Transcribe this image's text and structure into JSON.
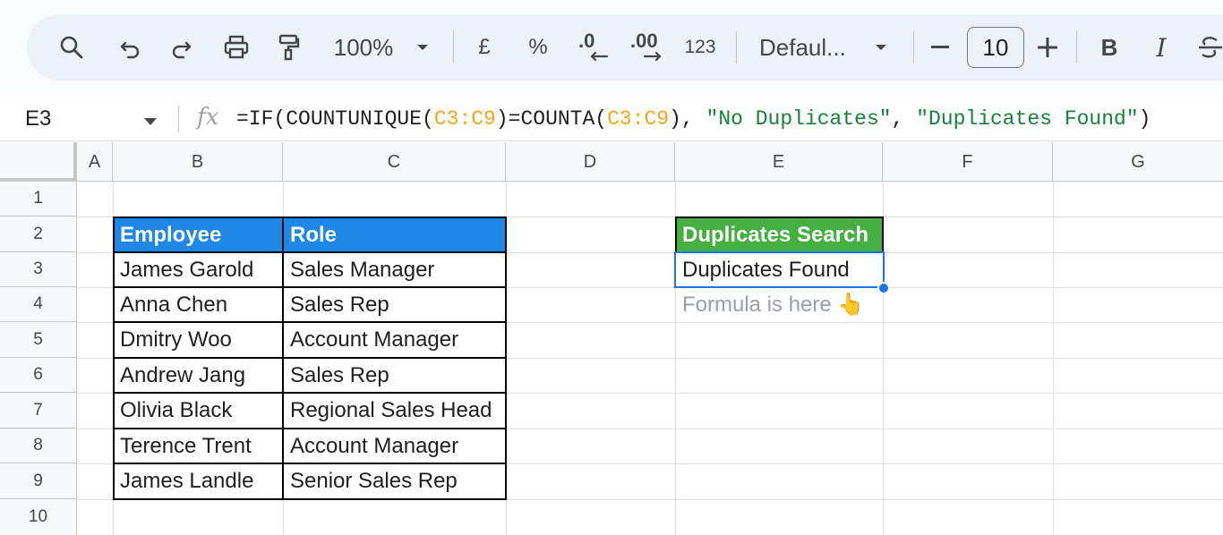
{
  "toolbar": {
    "zoom": "100%",
    "currency": "£",
    "percent": "%",
    "decrease_decimal": ".0",
    "increase_decimal": ".00",
    "number_format": "123",
    "font": "Defaul...",
    "font_size": "10",
    "bold": "B",
    "italic": "I"
  },
  "formula_bar": {
    "cell_ref": "E3",
    "fx": "fx",
    "formula_parts": {
      "p1": "=IF(COUNTUNIQUE(",
      "p2": "C3:C9",
      "p3": ")=COUNTA(",
      "p4": "C3:C9",
      "p5": "), ",
      "p6": "\"No Duplicates\"",
      "p7": ", ",
      "p8": "\"Duplicates Found\"",
      "p9": ")"
    }
  },
  "columns": [
    "A",
    "B",
    "C",
    "D",
    "E",
    "F",
    "G"
  ],
  "rows": [
    "1",
    "2",
    "3",
    "4",
    "5",
    "6",
    "7",
    "8",
    "9",
    "10"
  ],
  "table": {
    "headers": {
      "employee": "Employee",
      "role": "Role"
    },
    "rows": [
      {
        "employee": "James Garold",
        "role": "Sales Manager"
      },
      {
        "employee": "Anna Chen",
        "role": "Sales Rep"
      },
      {
        "employee": "Dmitry Woo",
        "role": "Account Manager"
      },
      {
        "employee": "Andrew Jang",
        "role": "Sales Rep"
      },
      {
        "employee": "Olivia Black",
        "role": "Regional Sales Head"
      },
      {
        "employee": "Terence Trent",
        "role": "Account Manager"
      },
      {
        "employee": "James Landle",
        "role": "Senior Sales Rep"
      }
    ]
  },
  "search": {
    "header": "Duplicates Search",
    "result": "Duplicates Found",
    "note": "Formula is here 👆"
  },
  "colors": {
    "header_blue": "#1f87e5",
    "header_green": "#45b041",
    "selection": "#1a73e8",
    "formula_ref": "#f4a61c",
    "formula_string": "#188038"
  }
}
